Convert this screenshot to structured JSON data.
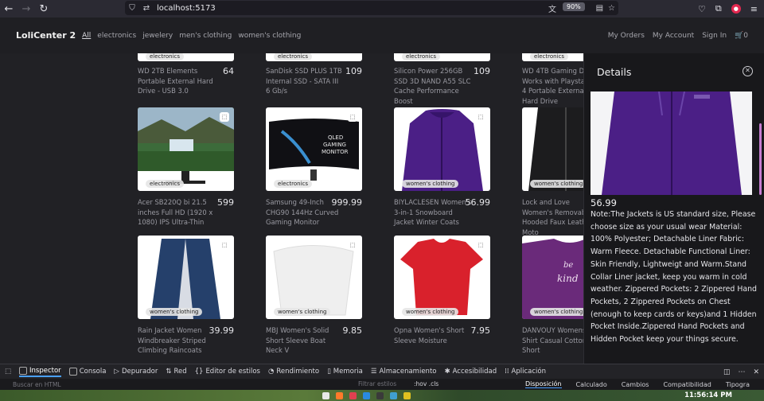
{
  "browser": {
    "url": "localhost:5173",
    "zoom": "90%"
  },
  "header": {
    "brand": "LoliCenter 2",
    "categories": [
      "All",
      "electronics",
      "jewelery",
      "men's clothing",
      "women's clothing"
    ],
    "right_links": [
      "My Orders",
      "My Account",
      "Sign In",
      "🛒0"
    ]
  },
  "products": [
    {
      "title": "WD 2TB Elements Portable External Hard Drive - USB 3.0",
      "price": "64",
      "category": "electronics"
    },
    {
      "title": "SanDisk SSD PLUS 1TB Internal SSD - SATA III 6 Gb/s",
      "price": "109",
      "category": "electronics"
    },
    {
      "title": "Silicon Power 256GB SSD 3D NAND A55 SLC Cache Performance Boost",
      "price": "109",
      "category": "electronics"
    },
    {
      "title": "WD 4TB Gaming Drive Works with Playstation 4 Portable External Hard Drive",
      "price": "",
      "category": "electronics"
    },
    {
      "title": "Acer SB220Q bi 21.5 inches Full HD (1920 x 1080) IPS Ultra-Thin",
      "price": "599",
      "category": "electronics"
    },
    {
      "title": "Samsung 49-Inch CHG90 144Hz Curved Gaming Monitor",
      "price": "999.99",
      "category": "electronics"
    },
    {
      "title": "BIYLACLESEN Women's 3-in-1 Snowboard Jacket Winter Coats",
      "price": "56.99",
      "category": "women's clothing"
    },
    {
      "title": "Lock and Love Women's Removable Hooded Faux Leather Moto",
      "price": "",
      "category": "women's clothing"
    },
    {
      "title": "Rain Jacket Women Windbreaker Striped Climbing Raincoats",
      "price": "39.99",
      "category": "women's clothing"
    },
    {
      "title": "MBJ Women's Solid Short Sleeve Boat Neck V",
      "price": "9.85",
      "category": "women's clothing"
    },
    {
      "title": "Opna Women's Short Sleeve Moisture",
      "price": "7.95",
      "category": "women's clothing"
    },
    {
      "title": "DANVOUY Womens T Shirt Casual Cotton Short",
      "price": "",
      "category": "women's clothing"
    }
  ],
  "details": {
    "title": "Details",
    "price": "56.99",
    "description": "Note:The Jackets is US standard size, Please choose size as your usual wear Material: 100% Polyester; Detachable Liner Fabric: Warm Fleece. Detachable Functional Liner: Skin Friendly, Lightweigt and Warm.Stand Collar Liner jacket, keep you warm in cold weather. Zippered Pockets: 2 Zippered Hand Pockets, 2 Zippered Pockets on Chest (enough to keep cards or keys)and 1 Hidden Pocket Inside.Zippered Hand Pockets and Hidden Pocket keep your things secure."
  },
  "devtools": {
    "tabs": [
      "Inspector",
      "Consola",
      "Depurador",
      "Red",
      "Editor de estilos",
      "Rendimiento",
      "Memoria",
      "Almacenamiento",
      "Accesibilidad",
      "Aplicación"
    ],
    "search_placeholder": "Buscar en HTML",
    "filter_placeholder": "Filtrar estilos",
    "hov_cls": ":hov .cls",
    "subtabs": [
      "Disposición",
      "Calculado",
      "Cambios",
      "Compatibilidad",
      "Tipogra"
    ]
  },
  "taskbar": {
    "clock": "11:56:14 PM"
  },
  "colors": {
    "accent": "#c77dd2",
    "jacket_purple": "#4b1f86"
  }
}
